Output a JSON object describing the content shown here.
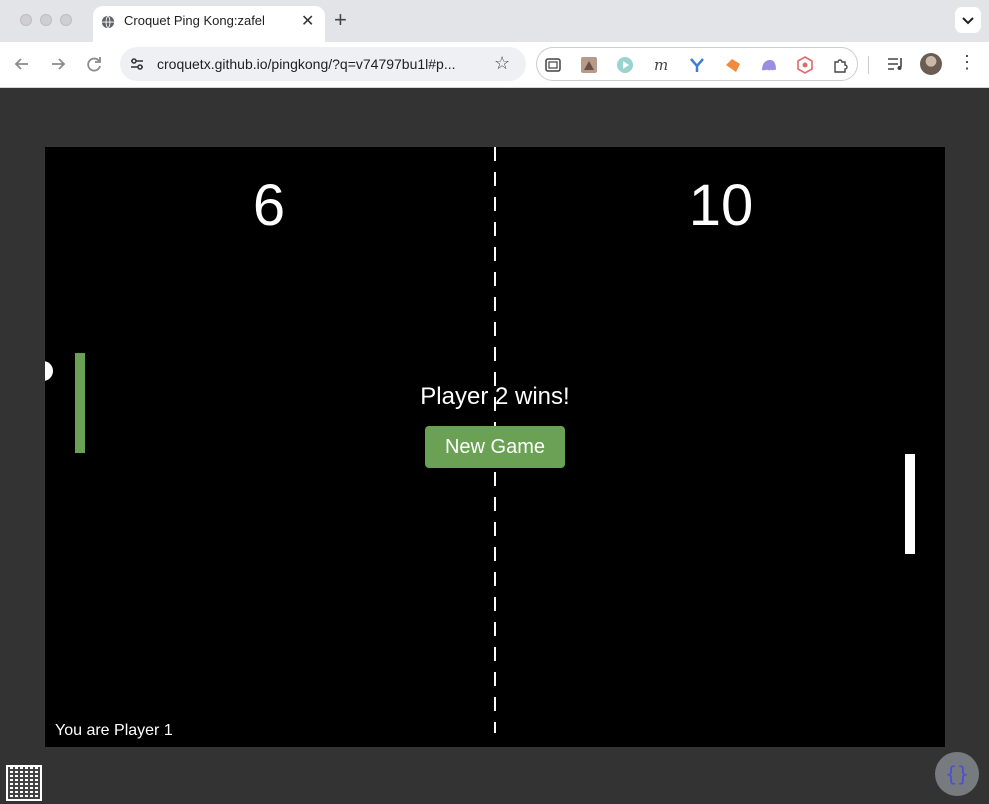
{
  "browser": {
    "tab": {
      "title": "Croquet Ping Kong:zafel",
      "favicon": "globe-icon",
      "close_icon": "close-icon"
    },
    "new_tab_icon": "plus-icon",
    "address": {
      "url": "croquetx.github.io/pingkong/?q=v74797bu1l#p..."
    },
    "icons": {
      "back": "arrow-left-icon",
      "forward": "arrow-right-icon",
      "reload": "reload-icon",
      "site_settings": "tune-icon",
      "bookmark": "star-icon",
      "menu": "more-vertical-icon"
    },
    "extensions": [
      "screen-capture-icon",
      "photo-extension-icon",
      "play-extension-icon",
      "m-extension-icon",
      "y-extension-icon",
      "fox-extension-icon",
      "ghost-extension-icon",
      "shield-extension-icon",
      "puzzle-icon"
    ],
    "colors": {
      "tabstrip": "#e3e4e8",
      "toolbar": "#ffffff",
      "omnibox": "#eef0f4"
    }
  },
  "game": {
    "score_left": "6",
    "score_right": "10",
    "win_message": "Player 2 wins!",
    "new_game_label": "New Game",
    "player_label": "You are Player 1",
    "colors": {
      "court": "#000000",
      "page": "#333333",
      "player1_paddle": "#6aa154",
      "player2_paddle": "#ffffff",
      "ball": "#ffffff",
      "button": "#6aa154"
    }
  },
  "footer": {
    "qr_icon": "qr-code-icon",
    "devtools_icon": "curly-braces-icon",
    "devtools_glyph": "{}"
  }
}
